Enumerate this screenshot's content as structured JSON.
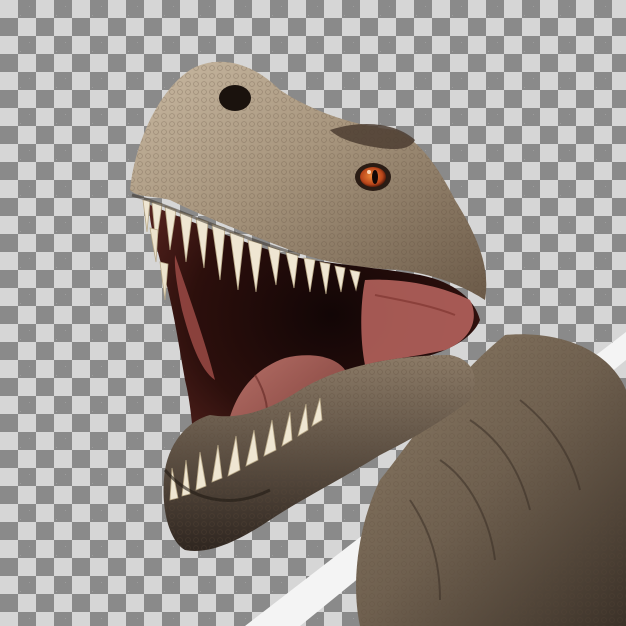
{
  "image": {
    "subject": "t-rex-head-roaring",
    "background": "transparency-checkerboard",
    "colors": {
      "checker_light": "#d6d6d6",
      "checker_dark": "#8a8a8a",
      "skin_light": "#b9a993",
      "skin_mid": "#8a7a66",
      "skin_dark": "#3b3128",
      "mouth_inner": "#2a0d0b",
      "gum_pink": "#b65a5a",
      "tongue": "#9a5a55",
      "teeth": "#efe6d2",
      "eye": "#c4561e"
    }
  }
}
